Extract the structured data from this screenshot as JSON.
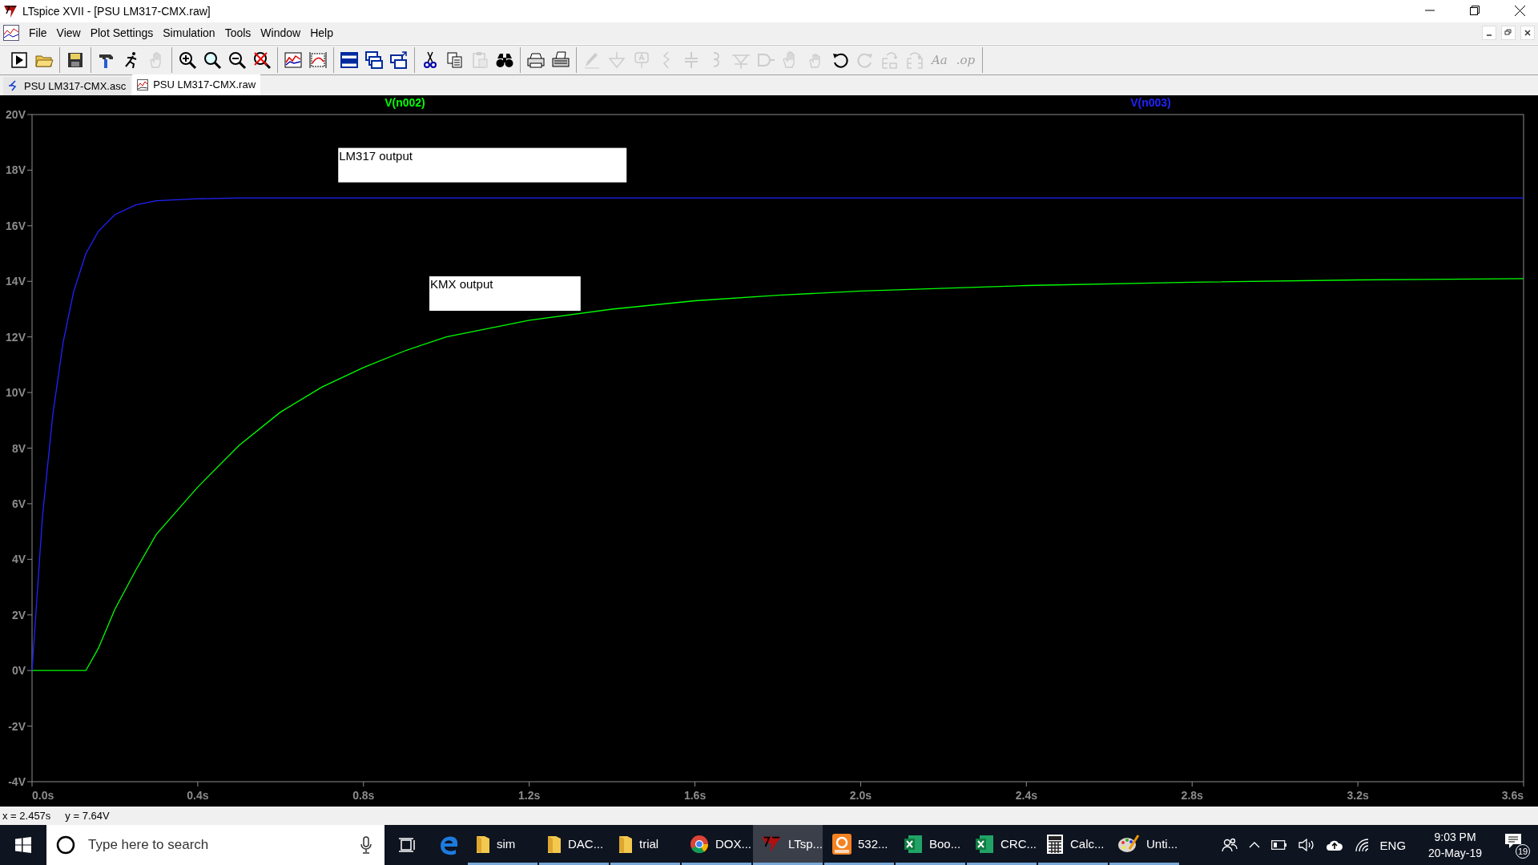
{
  "window": {
    "title": "LTspice XVII - [PSU LM317-CMX.raw]"
  },
  "menu": [
    "File",
    "View",
    "Plot Settings",
    "Simulation",
    "Tools",
    "Window",
    "Help"
  ],
  "toolbar": {
    "groups": [
      {
        "buttons": [
          {
            "kind": "run",
            "disabled": false
          },
          {
            "kind": "open",
            "disabled": false
          }
        ]
      },
      {
        "buttons": [
          {
            "kind": "save",
            "disabled": false
          }
        ]
      },
      {
        "buttons": [
          {
            "kind": "hammer",
            "disabled": false
          },
          {
            "kind": "runner",
            "disabled": false
          },
          {
            "kind": "hand",
            "disabled": true
          }
        ]
      },
      {
        "buttons": [
          {
            "kind": "zoom-in",
            "disabled": false
          },
          {
            "kind": "zoom",
            "disabled": false
          },
          {
            "kind": "zoom-out",
            "disabled": false
          },
          {
            "kind": "zoom-cancel",
            "disabled": false
          }
        ]
      },
      {
        "buttons": [
          {
            "kind": "plot",
            "disabled": false
          },
          {
            "kind": "autorange",
            "disabled": false
          }
        ]
      },
      {
        "buttons": [
          {
            "kind": "tile",
            "disabled": false
          },
          {
            "kind": "cascade",
            "disabled": false
          },
          {
            "kind": "tile2",
            "disabled": false
          }
        ]
      },
      {
        "buttons": [
          {
            "kind": "cut",
            "disabled": false
          },
          {
            "kind": "copy",
            "disabled": false
          },
          {
            "kind": "paste",
            "disabled": true
          },
          {
            "kind": "find",
            "disabled": false
          }
        ]
      },
      {
        "buttons": [
          {
            "kind": "print",
            "disabled": false
          },
          {
            "kind": "printer",
            "disabled": false
          }
        ]
      },
      {
        "buttons": [
          {
            "kind": "pencil",
            "disabled": true
          },
          {
            "kind": "ground",
            "disabled": true
          },
          {
            "kind": "label",
            "disabled": true
          },
          {
            "kind": "resistor",
            "disabled": true
          },
          {
            "kind": "capacitor",
            "disabled": true
          },
          {
            "kind": "inductor",
            "disabled": true
          },
          {
            "kind": "diode",
            "disabled": true
          },
          {
            "kind": "component",
            "disabled": true
          },
          {
            "kind": "drag",
            "disabled": true
          },
          {
            "kind": "move",
            "disabled": true
          },
          {
            "kind": "undo",
            "disabled": false
          },
          {
            "kind": "redo",
            "disabled": true
          },
          {
            "kind": "rotate",
            "disabled": true
          },
          {
            "kind": "mirror",
            "disabled": true
          },
          {
            "kind": "glyph",
            "glyph": "Aa",
            "disabled": true
          },
          {
            "kind": "glyph",
            "glyph": ".op",
            "disabled": true
          }
        ]
      }
    ]
  },
  "tabs": [
    {
      "label": "PSU LM317-CMX.asc",
      "kind": "schematic",
      "selected": false
    },
    {
      "label": "PSU LM317-CMX.raw",
      "kind": "waveform",
      "selected": true
    }
  ],
  "plot": {
    "chart_data": {
      "type": "line",
      "x": [
        0,
        0.025,
        0.05,
        0.075,
        0.1,
        0.13,
        0.16,
        0.2,
        0.25,
        0.3,
        0.4,
        0.5,
        0.6,
        0.7,
        0.8,
        0.9,
        1.0,
        1.2,
        1.4,
        1.6,
        1.8,
        2.0,
        2.4,
        2.8,
        3.2,
        3.6
      ],
      "series": [
        {
          "name": "V(n002)",
          "color": "#00ff00",
          "values": [
            0,
            0,
            0,
            0,
            0,
            0,
            0.8,
            2.2,
            3.6,
            4.9,
            6.6,
            8.1,
            9.3,
            10.2,
            10.9,
            11.5,
            12.0,
            12.6,
            13.0,
            13.3,
            13.5,
            13.65,
            13.85,
            13.97,
            14.05,
            14.1
          ]
        },
        {
          "name": "V(n003)",
          "color": "#2222ff",
          "values": [
            0,
            5.5,
            9.2,
            11.8,
            13.6,
            15.0,
            15.8,
            16.4,
            16.75,
            16.9,
            16.97,
            17,
            17,
            17,
            17,
            17,
            17,
            17,
            17,
            17,
            17,
            17,
            17,
            17,
            17,
            17
          ]
        }
      ],
      "xlim": [
        0,
        3.6
      ],
      "ylim": [
        -4,
        20
      ],
      "xticks": [
        {
          "value": 0,
          "label": "0.0s"
        },
        {
          "value": 0.4,
          "label": "0.4s"
        },
        {
          "value": 0.8,
          "label": "0.8s"
        },
        {
          "value": 1.2,
          "label": "1.2s"
        },
        {
          "value": 1.6,
          "label": "1.6s"
        },
        {
          "value": 2.0,
          "label": "2.0s"
        },
        {
          "value": 2.4,
          "label": "2.4s"
        },
        {
          "value": 2.8,
          "label": "2.8s"
        },
        {
          "value": 3.2,
          "label": "3.2s"
        },
        {
          "value": 3.6,
          "label": "3.6s"
        }
      ],
      "yticks": [
        {
          "value": 20,
          "label": "20V"
        },
        {
          "value": 18,
          "label": "18V"
        },
        {
          "value": 16,
          "label": "16V"
        },
        {
          "value": 14,
          "label": "14V"
        },
        {
          "value": 12,
          "label": "12V"
        },
        {
          "value": 10,
          "label": "10V"
        },
        {
          "value": 8,
          "label": "8V"
        },
        {
          "value": 6,
          "label": "6V"
        },
        {
          "value": 4,
          "label": "4V"
        },
        {
          "value": 2,
          "label": "2V"
        },
        {
          "value": 0,
          "label": "0V"
        },
        {
          "value": -2,
          "label": "-2V"
        },
        {
          "value": -4,
          "label": "-4V"
        }
      ],
      "annotations": [
        "LM317 output",
        "KMX output"
      ]
    }
  },
  "status_bar": {
    "x_reading": "x = 2.457s",
    "y_reading": "y = 7.64V"
  },
  "taskbar": {
    "search": {
      "placeholder": "Type here to search"
    },
    "apps": [
      {
        "label": "sim",
        "kind": "folder",
        "selected": false
      },
      {
        "label": "DAC...",
        "kind": "folder",
        "selected": false
      },
      {
        "label": "trial",
        "kind": "folder",
        "selected": false
      },
      {
        "label": "DOX...",
        "kind": "chrome",
        "selected": false
      },
      {
        "label": "LTsp...",
        "kind": "ltspice",
        "selected": true
      },
      {
        "label": "532...",
        "kind": "pdf",
        "selected": false
      },
      {
        "label": "Boo...",
        "kind": "excel",
        "selected": false
      },
      {
        "label": "CRC...",
        "kind": "excel",
        "selected": false
      },
      {
        "label": "Calc...",
        "kind": "calculator",
        "selected": false
      },
      {
        "label": "Unti...",
        "kind": "paint",
        "selected": false
      }
    ],
    "language": "ENG",
    "time": "9:03 PM",
    "date": "20-May-19",
    "notifications": "19"
  }
}
